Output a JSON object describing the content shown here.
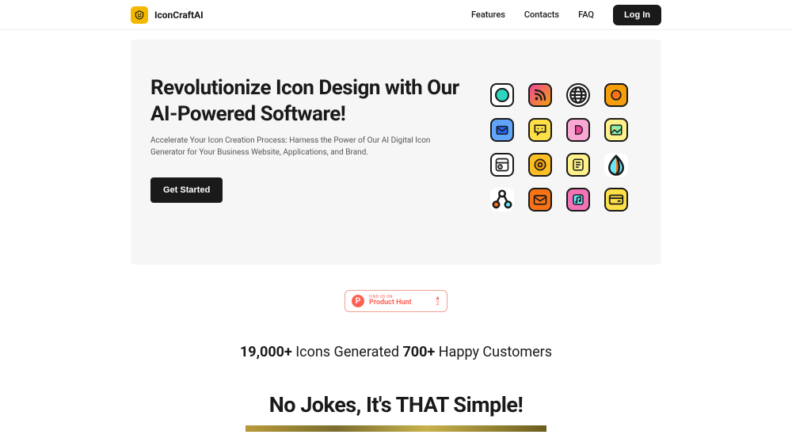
{
  "brand": {
    "name": "IconCraftAI"
  },
  "nav": {
    "features": "Features",
    "contacts": "Contacts",
    "faq": "FAQ",
    "login": "Log In"
  },
  "hero": {
    "title": "Revolutionize Icon Design with Our AI-Powered Software!",
    "subtitle": "Accelerate Your Icon Creation Process: Harness the Power of Our AI Digital Icon Generator for Your Business Website, Applications, and Brand.",
    "cta": "Get Started"
  },
  "producthunt": {
    "tagline": "FIND US ON",
    "name": "Product Hunt",
    "upvotes": "2"
  },
  "stats": {
    "icons_count": "19,000+",
    "icons_label": " Icons Generated ",
    "customers_count": "700+",
    "customers_label": " Happy Customers"
  },
  "simple": {
    "heading": "No Jokes, It's THAT Simple!"
  }
}
